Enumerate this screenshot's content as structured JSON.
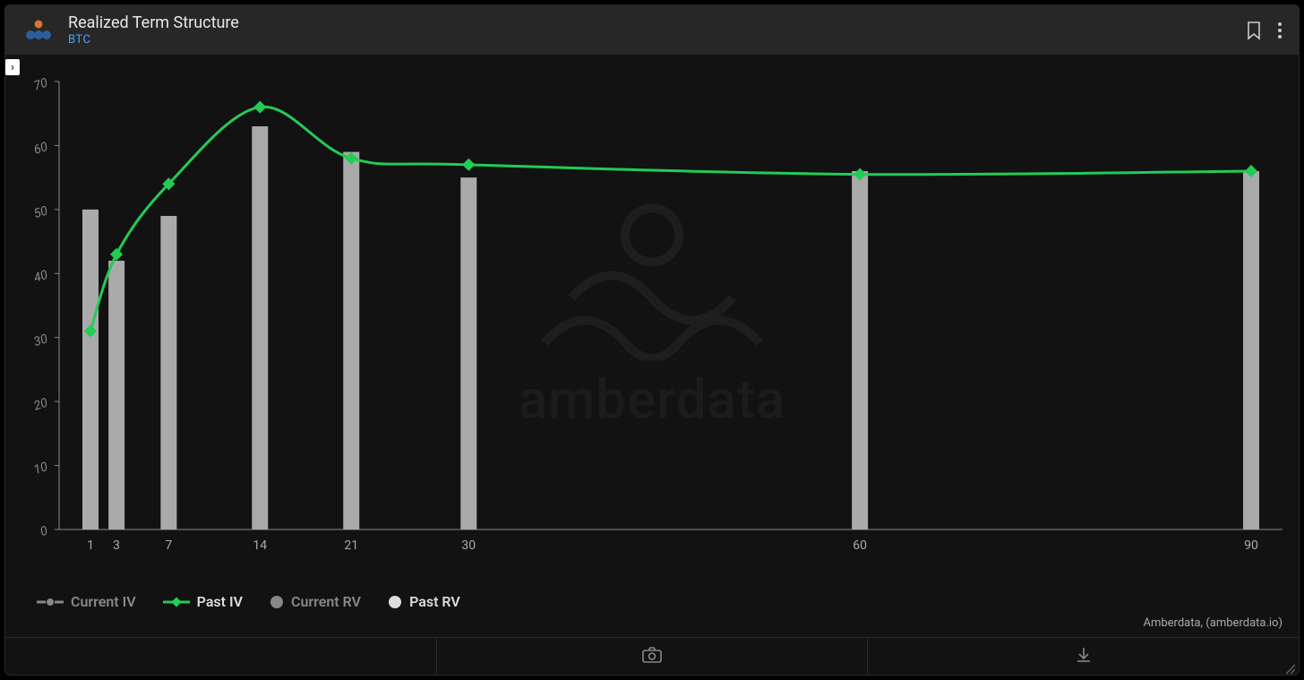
{
  "header": {
    "title": "Realized Term Structure",
    "subtitle": "BTC"
  },
  "legend": {
    "current_iv": "Current IV",
    "past_iv": "Past IV",
    "current_rv": "Current RV",
    "past_rv": "Past RV"
  },
  "attribution": "Amberdata, (amberdata.io)",
  "watermark": "amberdata",
  "colors": {
    "past_iv": "#22cc55",
    "bar": "#aaaaaa",
    "axis": "#888888"
  },
  "chart_data": {
    "type": "bar+line",
    "title": "Realized Term Structure",
    "xlabel": "",
    "ylabel": "",
    "ylim": [
      0,
      70
    ],
    "y_ticks": [
      0,
      10,
      20,
      30,
      40,
      50,
      60,
      70
    ],
    "categories": [
      1,
      3,
      7,
      14,
      21,
      30,
      60,
      90
    ],
    "series": [
      {
        "name": "Past RV",
        "type": "bar",
        "values": [
          50,
          42,
          49,
          63,
          59,
          55,
          56,
          56
        ]
      },
      {
        "name": "Past IV",
        "type": "line",
        "values": [
          31,
          43,
          54,
          66,
          58,
          57,
          55.5,
          56
        ]
      },
      {
        "name": "Current IV",
        "type": "line",
        "values": null
      },
      {
        "name": "Current RV",
        "type": "bar",
        "values": null
      }
    ]
  }
}
